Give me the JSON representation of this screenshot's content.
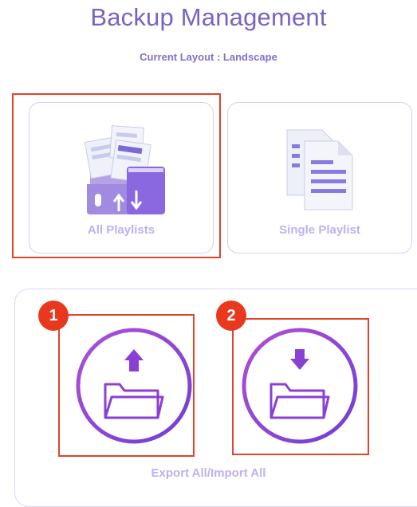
{
  "header": {
    "title": "Backup Management",
    "subtitle": "Current Layout : Landscape"
  },
  "modes": [
    {
      "label": "All Playlists",
      "icon": "playlists-folder-icon",
      "selected": true
    },
    {
      "label": "Single Playlist",
      "icon": "document-icon",
      "selected": false
    }
  ],
  "actions": {
    "label": "Export All/Import All",
    "export": {
      "badge": "1",
      "icon": "folder-upload-icon"
    },
    "import": {
      "badge": "2",
      "icon": "folder-download-icon"
    }
  },
  "colors": {
    "accent": "#7a62c4",
    "label_muted": "#c0b1ee",
    "highlight": "#e0442a",
    "badge": "#e8381e"
  }
}
